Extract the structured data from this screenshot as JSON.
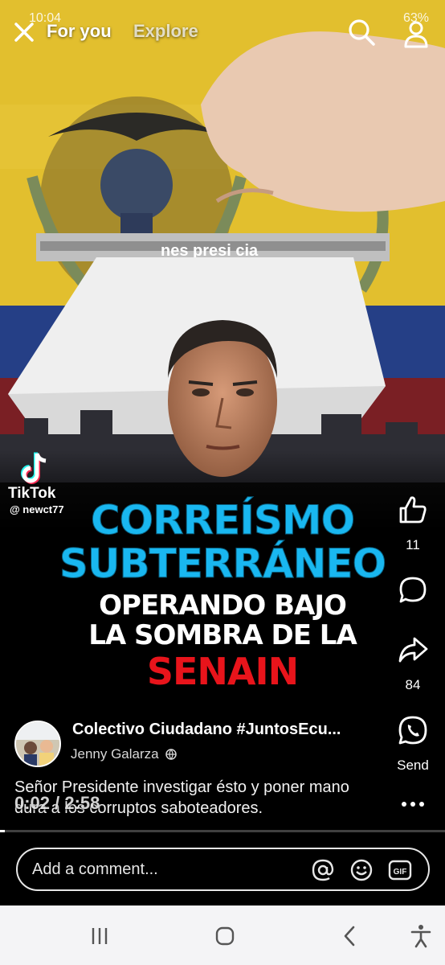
{
  "status": {
    "time": "10:04",
    "battery": "63%"
  },
  "topnav": {
    "tabs": [
      {
        "label": "For you",
        "active": true
      },
      {
        "label": "Explore",
        "active": false
      }
    ]
  },
  "video": {
    "watermark": {
      "app": "TikTok",
      "handle": "@ newct77"
    },
    "headline": {
      "line1": "CORREÍSMO",
      "line2": "SUBTERRÁNEO",
      "line3": "OPERANDO BAJO",
      "line4": "LA SOMBRA DE LA",
      "line5": "SENAIN"
    },
    "ballot_text": "nes presi      cia"
  },
  "actions": {
    "like": {
      "icon": "thumbs-up-icon",
      "count": "11"
    },
    "comment": {
      "icon": "comment-bubble-icon"
    },
    "share": {
      "icon": "share-arrow-icon",
      "count": "84"
    },
    "send": {
      "icon": "whatsapp-icon",
      "label": "Send"
    },
    "more": {
      "icon": "more-dots-icon"
    }
  },
  "post": {
    "group_name": "Colectivo Ciudadano #JuntosEcu...",
    "author": "Jenny Galarza",
    "caption": "Señor Presidente investigar ésto y poner mano dura a los corruptos saboteadores.",
    "time_current": "0:02",
    "time_total": "2:58",
    "time_display": "0:02 / 2:58",
    "progress": 0.011
  },
  "comment_bar": {
    "placeholder": "Add a comment..."
  },
  "colors": {
    "headline_blue": "#19b7f0",
    "headline_red": "#e8141b",
    "nav_bg": "#f4f4f6"
  }
}
